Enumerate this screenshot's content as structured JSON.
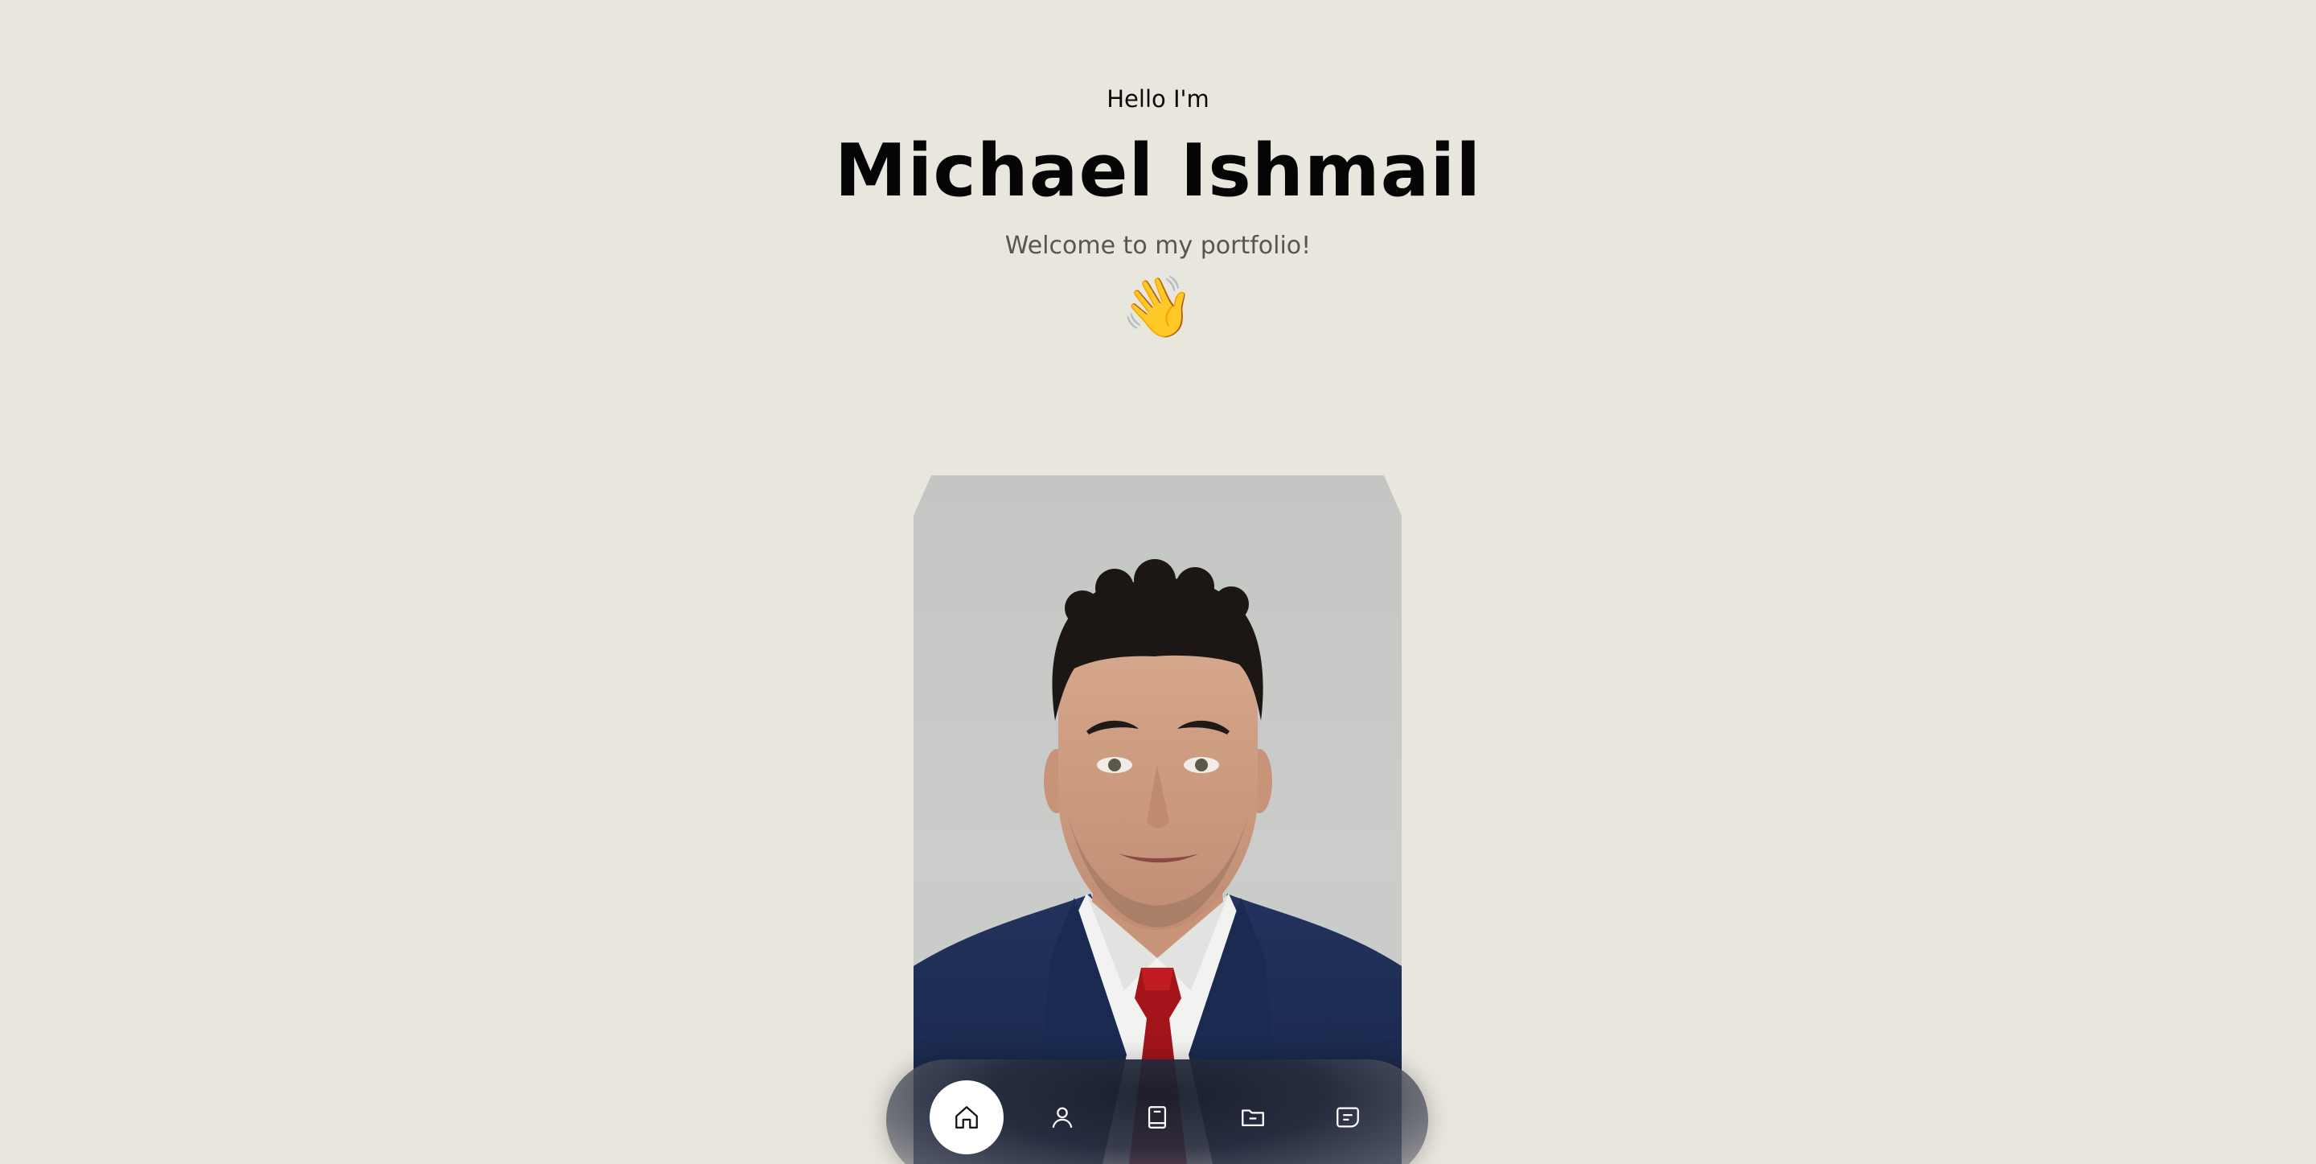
{
  "hero": {
    "greeting": "Hello I'm",
    "name": "Michael Ishmail",
    "tagline": "Welcome to my portfolio!",
    "wave_emoji": "👋"
  },
  "profile_photo": {
    "alt": "Michael Ishmail"
  },
  "nav": {
    "items": [
      {
        "icon": "home-icon",
        "active": true
      },
      {
        "icon": "user-icon",
        "active": false
      },
      {
        "icon": "book-icon",
        "active": false
      },
      {
        "icon": "folder-icon",
        "active": false
      },
      {
        "icon": "message-icon",
        "active": false
      }
    ]
  },
  "colors": {
    "background": "#e9e6de",
    "text": "#050505",
    "subtext": "#555555",
    "nav_bg": "#1f2435",
    "nav_active": "#ffffff",
    "tie": "#a3141b",
    "suit": "#1f2f57"
  }
}
